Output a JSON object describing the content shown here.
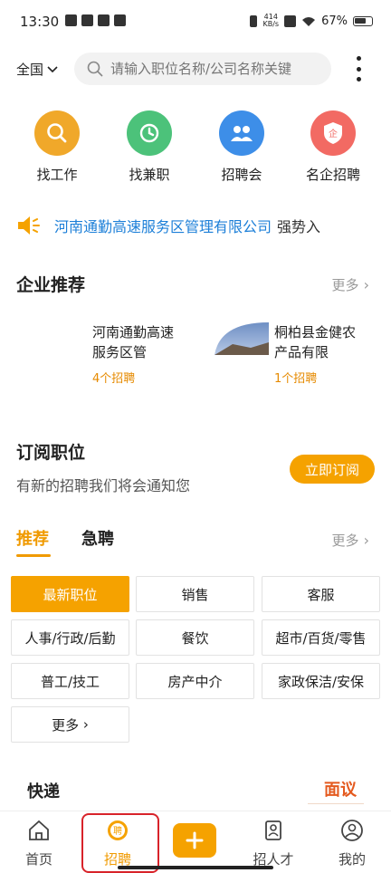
{
  "status": {
    "time": "13:30",
    "netspeed_value": "414",
    "netspeed_unit": "KB/s",
    "battery": "67%"
  },
  "header": {
    "region": "全国",
    "search_placeholder": "请输入职位名称/公司名称关键"
  },
  "quicknav": [
    {
      "label": "找工作",
      "color": "#f0a82a",
      "icon": "search-icon"
    },
    {
      "label": "找兼职",
      "color": "#4cc27a",
      "icon": "clock-icon"
    },
    {
      "label": "招聘会",
      "color": "#3d8ee8",
      "icon": "people-icon"
    },
    {
      "label": "名企招聘",
      "color": "#f26a63",
      "icon": "shield-icon",
      "badge": "企"
    }
  ],
  "notice": {
    "company": "河南通勤高速服务区管理有限公司",
    "suffix": "强势入"
  },
  "featured": {
    "title": "企业推荐",
    "more": "更多",
    "companies": [
      {
        "name": "河南通勤高速服务区管",
        "openings": "4个招聘"
      },
      {
        "name": "桐柏县金健农产品有限",
        "openings": "1个招聘"
      }
    ]
  },
  "subscribe": {
    "title": "订阅职位",
    "desc": "有新的招聘我们将会通知您",
    "button": "立即订阅"
  },
  "job_tabs": {
    "tabs": [
      "推荐",
      "急聘"
    ],
    "more": "更多"
  },
  "categories": [
    "最新职位",
    "销售",
    "客服",
    "人事/行政/后勤",
    "餐饮",
    "超市/百货/零售",
    "普工/技工",
    "房产中介",
    "家政保洁/安保",
    "更多"
  ],
  "listing_preview": {
    "title": "快递",
    "salary": "面议"
  },
  "tabbar": {
    "items": [
      "首页",
      "招聘",
      "招人才",
      "我的"
    ],
    "recruit_badge": "聘",
    "plus": "+"
  },
  "colors": {
    "accent": "#f5a200",
    "link": "#1c7fd8",
    "highlight": "#d8232a"
  }
}
